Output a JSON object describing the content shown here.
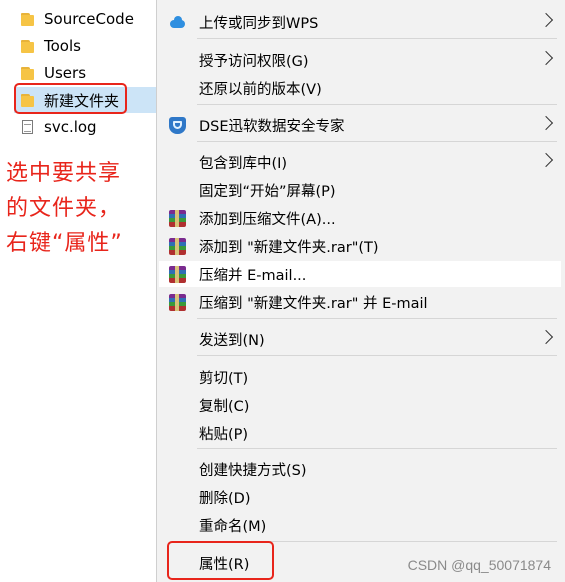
{
  "explorer": {
    "items": [
      {
        "label": "SourceCode",
        "icon": "folder-icon"
      },
      {
        "label": "Tools",
        "icon": "folder-icon"
      },
      {
        "label": "Users",
        "icon": "folder-icon"
      },
      {
        "label": "新建文件夹",
        "icon": "folder-icon",
        "selected": true
      },
      {
        "label": "svc.log",
        "icon": "file-icon"
      }
    ]
  },
  "annotation": {
    "lines": [
      "选中要共享",
      "的文件夹，",
      "右键“属性”"
    ],
    "color": "#e8251b"
  },
  "context_menu": {
    "upload_wps": "上传或同步到WPS",
    "grant_access": "授予访问权限(G)",
    "restore_versions": "还原以前的版本(V)",
    "dse": "DSE迅软数据安全专家",
    "include_library": "包含到库中(I)",
    "pin_start": "固定到“开始”屏幕(P)",
    "add_archive": "添加到压缩文件(A)...",
    "add_rar": "添加到 \"新建文件夹.rar\"(T)",
    "compress_email": "压缩并 E-mail...",
    "compress_rar_email": "压缩到 \"新建文件夹.rar\" 并 E-mail",
    "send_to": "发送到(N)",
    "cut": "剪切(T)",
    "copy": "复制(C)",
    "paste": "粘贴(P)",
    "create_shortcut": "创建快捷方式(S)",
    "delete": "删除(D)",
    "rename": "重命名(M)",
    "properties": "属性(R)"
  },
  "watermark": "CSDN @qq_50071874",
  "colors": {
    "menu_background": "#f2f2f2",
    "highlight_box": "#e8251b",
    "selection": "#cce4f7"
  }
}
